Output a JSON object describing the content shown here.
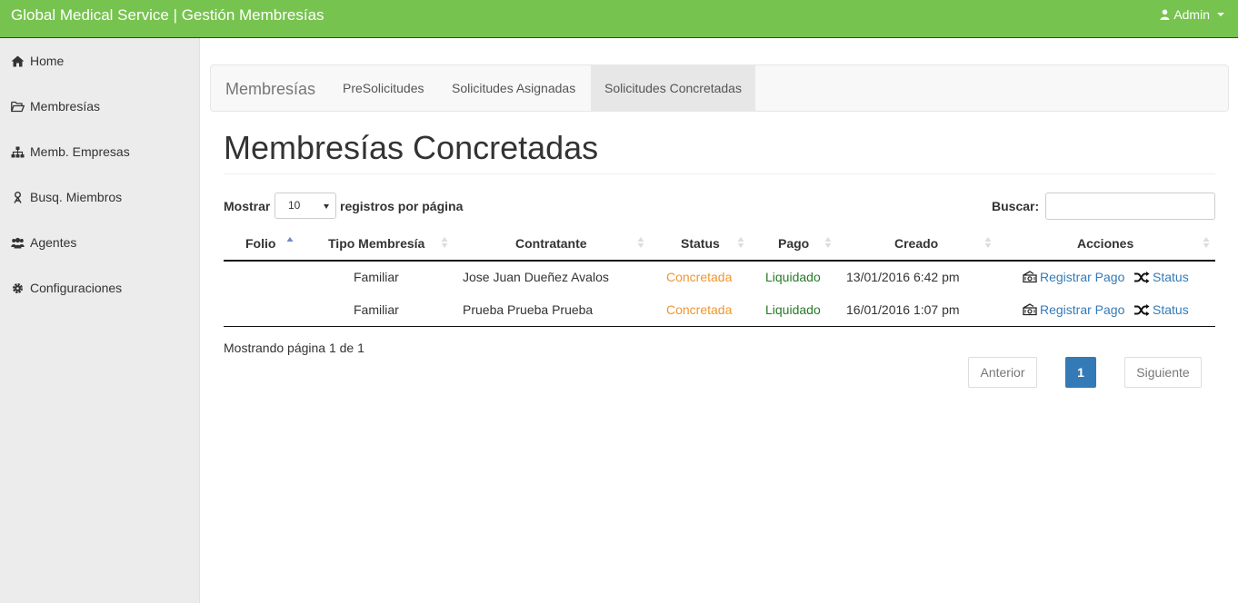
{
  "header": {
    "brand": "Global Medical Service | Gestión Membresías",
    "user": "Admin"
  },
  "sidebar": {
    "items": [
      {
        "label": "Home",
        "icon": "home-icon"
      },
      {
        "label": "Membresías",
        "icon": "folder-open-icon"
      },
      {
        "label": "Memb. Empresas",
        "icon": "sitemap-icon"
      },
      {
        "label": "Busq. Miembros",
        "icon": "user-search-icon"
      },
      {
        "label": "Agentes",
        "icon": "users-icon"
      },
      {
        "label": "Configuraciones",
        "icon": "gear-icon"
      }
    ]
  },
  "subnav": {
    "brand": "Membresías",
    "tabs": [
      {
        "label": "PreSolicitudes"
      },
      {
        "label": "Solicitudes Asignadas"
      },
      {
        "label": "Solicitudes Concretadas",
        "active": true
      }
    ]
  },
  "page": {
    "title": "Membresías Concretadas"
  },
  "table_controls": {
    "show_label": "Mostrar",
    "page_size": "10",
    "per_page_label": "registros por página",
    "search_label": "Buscar:",
    "search_value": ""
  },
  "table": {
    "columns": [
      "Folio",
      "Tipo Membresía",
      "Contratante",
      "Status",
      "Pago",
      "Creado",
      "Acciones"
    ],
    "rows": [
      {
        "folio": "",
        "tipo": "Familiar",
        "contratante": "Jose Juan Dueñez Avalos",
        "status": "Concretada",
        "pago": "Liquidado",
        "creado": "13/01/2016 6:42 pm",
        "action_pay": "Registrar Pago",
        "action_status": "Status"
      },
      {
        "folio": "",
        "tipo": "Familiar",
        "contratante": "Prueba Prueba Prueba",
        "status": "Concretada",
        "pago": "Liquidado",
        "creado": "16/01/2016 1:07 pm",
        "action_pay": "Registrar Pago",
        "action_status": "Status"
      }
    ]
  },
  "footer": {
    "info": "Mostrando página 1 de 1",
    "prev": "Anterior",
    "current_page": "1",
    "next": "Siguiente"
  },
  "colors": {
    "navbar": "#77c34f",
    "status_orange": "#f0962e",
    "pago_green": "#267a26",
    "link_blue": "#337ab7"
  }
}
